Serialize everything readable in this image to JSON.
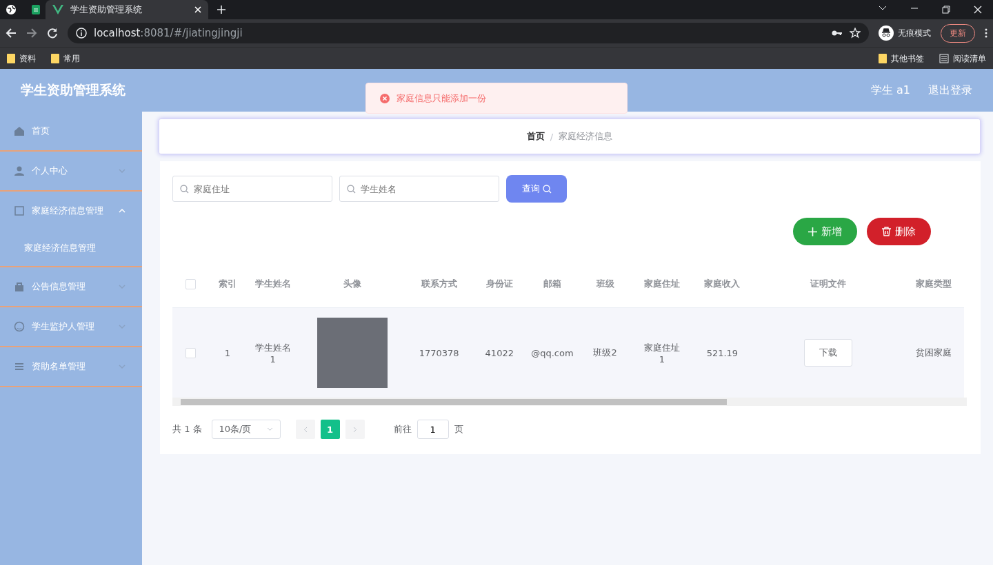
{
  "browser": {
    "tabs": [
      {
        "title": "学生资助管理系统",
        "selected": true
      }
    ],
    "url_host": "localhost",
    "url_path": ":8081/#/jiatingjingji",
    "profile": "无痕模式",
    "update_button": "更新",
    "bookmarks": [
      "资料",
      "常用"
    ],
    "bookmarks_right": [
      "其他书签",
      "阅读清单"
    ]
  },
  "app": {
    "title": "学生资助管理系统",
    "user": "学生 a1",
    "logout": "退出登录"
  },
  "toast": {
    "message": "家庭信息只能添加一份"
  },
  "sidebar": {
    "items": [
      {
        "label": "首页"
      },
      {
        "label": "个人中心",
        "expanded": false
      },
      {
        "label": "家庭经济信息管理",
        "expanded": true,
        "children": [
          {
            "label": "家庭经济信息管理"
          }
        ]
      },
      {
        "label": "公告信息管理",
        "expanded": false
      },
      {
        "label": "学生监护人管理",
        "expanded": false
      },
      {
        "label": "资助名单管理",
        "expanded": false
      }
    ]
  },
  "breadcrumb": {
    "items": [
      "首页",
      "家庭经济信息"
    ],
    "separator": "/"
  },
  "search": {
    "fields": [
      {
        "placeholder": "家庭住址"
      },
      {
        "placeholder": "学生姓名"
      }
    ],
    "button": "查询"
  },
  "actions": [
    {
      "label": "新增",
      "kind": "add"
    },
    {
      "label": "删除",
      "kind": "delete"
    }
  ],
  "table": {
    "all_checked": false,
    "columns": [
      "索引",
      "学生姓名",
      "头像",
      "联系方式",
      "身份证",
      "邮箱",
      "班级",
      "家庭住址",
      "家庭收入",
      "证明文件",
      "家庭类型"
    ],
    "rows": [
      {
        "checked": false,
        "cells": [
          "1",
          "学生姓名1",
          "",
          "1770378",
          "41022",
          "@qq.com",
          "班级2",
          "家庭住址1",
          "521.19",
          "下载",
          "贫困家庭"
        ]
      }
    ]
  },
  "pager": {
    "total": "共 1 条",
    "page_size": "10条/页",
    "pages": [
      {
        "label": "1",
        "selected": true
      }
    ],
    "goto_label": "前往",
    "goto_value": "1",
    "goto_suffix": "页"
  }
}
